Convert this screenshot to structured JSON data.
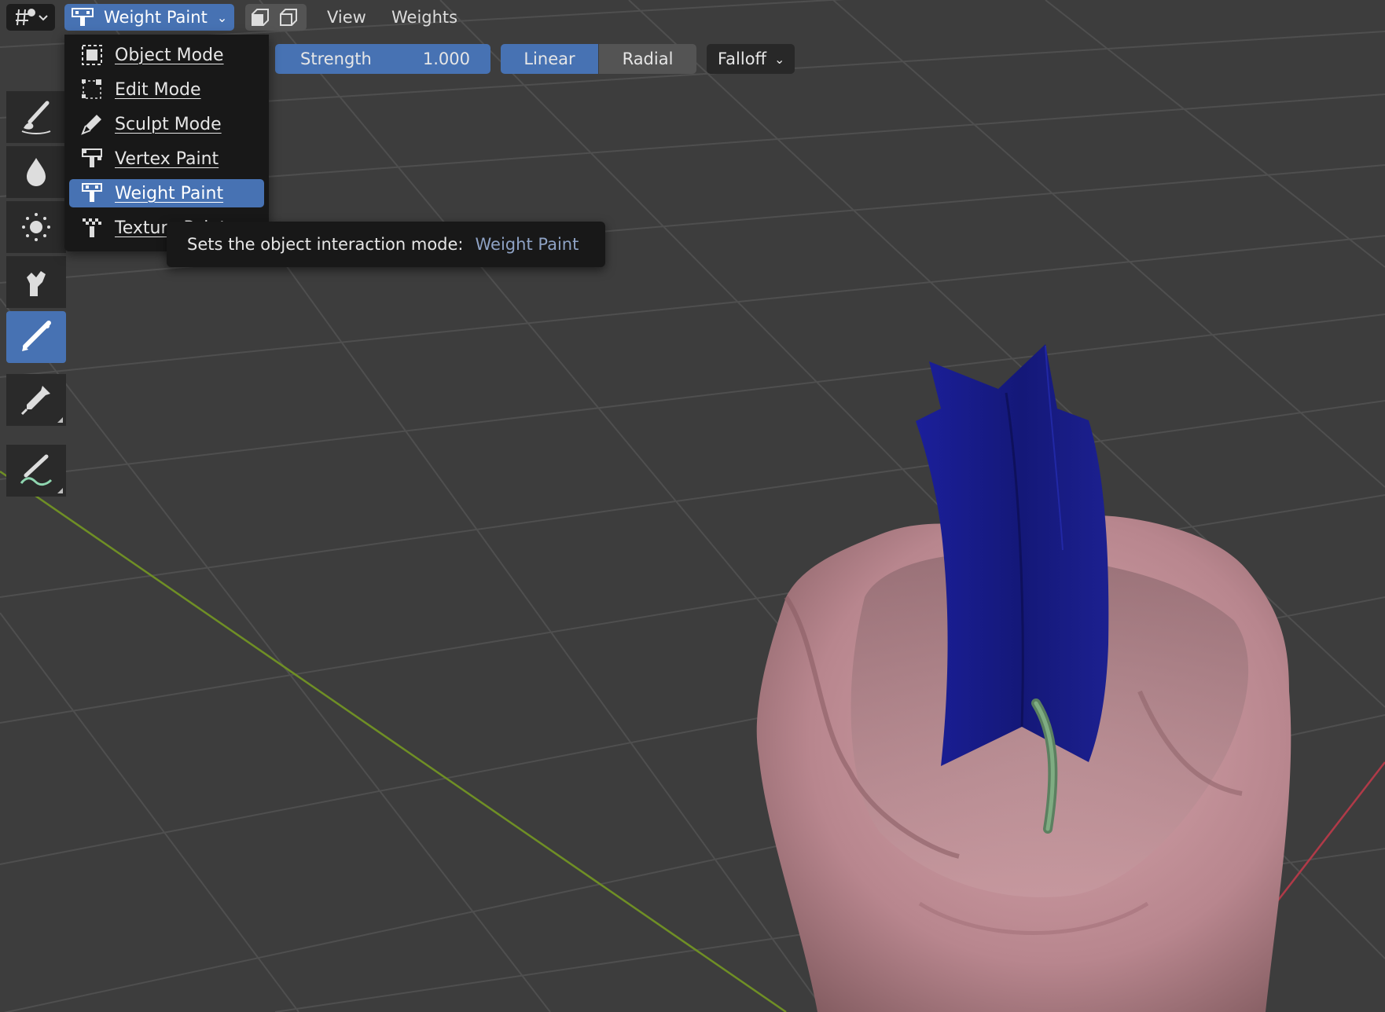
{
  "header": {
    "editor_type_icon": "viewport-shading-icon",
    "mode_label": "Weight Paint",
    "menus": [
      "View",
      "Weights"
    ]
  },
  "tool_settings": {
    "strength_label": "Strength",
    "strength_value": "1.000",
    "falloff_shape_options": [
      "Linear",
      "Radial"
    ],
    "falloff_shape_selected": "Linear",
    "falloff_menu_label": "Falloff"
  },
  "toolbar": {
    "tools": [
      "draw-brush-icon",
      "blur-icon",
      "average-icon",
      "smear-icon",
      "gradient-icon",
      "sample-weight-icon",
      "annotate-icon"
    ],
    "active_tool": "gradient-icon"
  },
  "mode_dropdown": {
    "items": [
      {
        "label": "Object Mode",
        "icon": "object-mode-icon"
      },
      {
        "label": "Edit Mode",
        "icon": "edit-mode-icon"
      },
      {
        "label": "Sculpt Mode",
        "icon": "sculpt-mode-icon"
      },
      {
        "label": "Vertex Paint",
        "icon": "vertex-paint-icon"
      },
      {
        "label": "Weight Paint",
        "icon": "weight-paint-icon"
      },
      {
        "label": "Texture Paint",
        "icon": "texture-paint-icon"
      }
    ],
    "selected": "Weight Paint"
  },
  "tooltip": {
    "text": "Sets the object interaction mode:",
    "value": "Weight Paint"
  },
  "colors": {
    "accent": "#4772b3",
    "viewport_bg": "#3d3d3d",
    "mesh_skin": "#b8868e",
    "mesh_weight_blue": "#1a1d8a",
    "mesh_stem": "#7aa37e"
  }
}
